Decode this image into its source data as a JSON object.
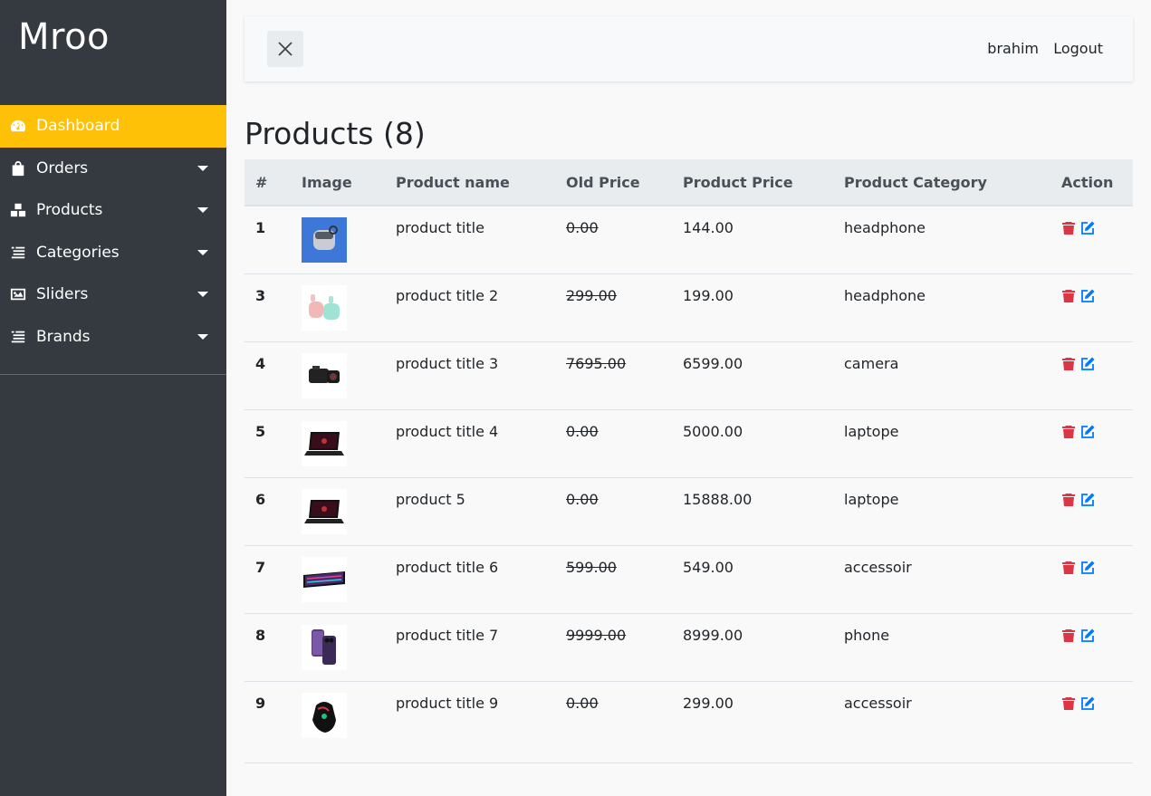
{
  "brand": "Mroo",
  "sidebar": {
    "items": [
      {
        "label": "Dashboard"
      },
      {
        "label": "Orders"
      },
      {
        "label": "Products"
      },
      {
        "label": "Categories"
      },
      {
        "label": "Sliders"
      },
      {
        "label": "Brands"
      }
    ],
    "active_color": "#ffc107",
    "background": "#343a40"
  },
  "topbar": {
    "username": "brahim",
    "logout_label": "Logout"
  },
  "page": {
    "title": "Products (8)"
  },
  "table": {
    "headers": [
      "#",
      "Image",
      "Product name",
      "Old Price",
      "Product Price",
      "Product Category",
      "Action"
    ],
    "rows": [
      {
        "id": "1",
        "image": "airpods-case-icon",
        "name": "product title",
        "old_price": "0.00",
        "price": "144.00",
        "category": "headphone"
      },
      {
        "id": "3",
        "image": "earbuds-icon",
        "name": "product title 2",
        "old_price": "299.00",
        "price": "199.00",
        "category": "headphone"
      },
      {
        "id": "4",
        "image": "camera-icon",
        "name": "product title 3",
        "old_price": "7695.00",
        "price": "6599.00",
        "category": "camera"
      },
      {
        "id": "5",
        "image": "laptop-icon",
        "name": "product title 4",
        "old_price": "0.00",
        "price": "5000.00",
        "category": "laptope"
      },
      {
        "id": "6",
        "image": "laptop-icon",
        "name": "product 5",
        "old_price": "0.00",
        "price": "15888.00",
        "category": "laptope"
      },
      {
        "id": "7",
        "image": "keyboard-icon",
        "name": "product title 6",
        "old_price": "599.00",
        "price": "549.00",
        "category": "accessoir"
      },
      {
        "id": "8",
        "image": "phone-icon",
        "name": "product title 7",
        "old_price": "9999.00",
        "price": "8999.00",
        "category": "phone"
      },
      {
        "id": "9",
        "image": "mouse-icon",
        "name": "product title 9",
        "old_price": "0.00",
        "price": "299.00",
        "category": "accessoir"
      }
    ]
  },
  "colors": {
    "delete": "#dc3545",
    "edit": "#007bff"
  }
}
